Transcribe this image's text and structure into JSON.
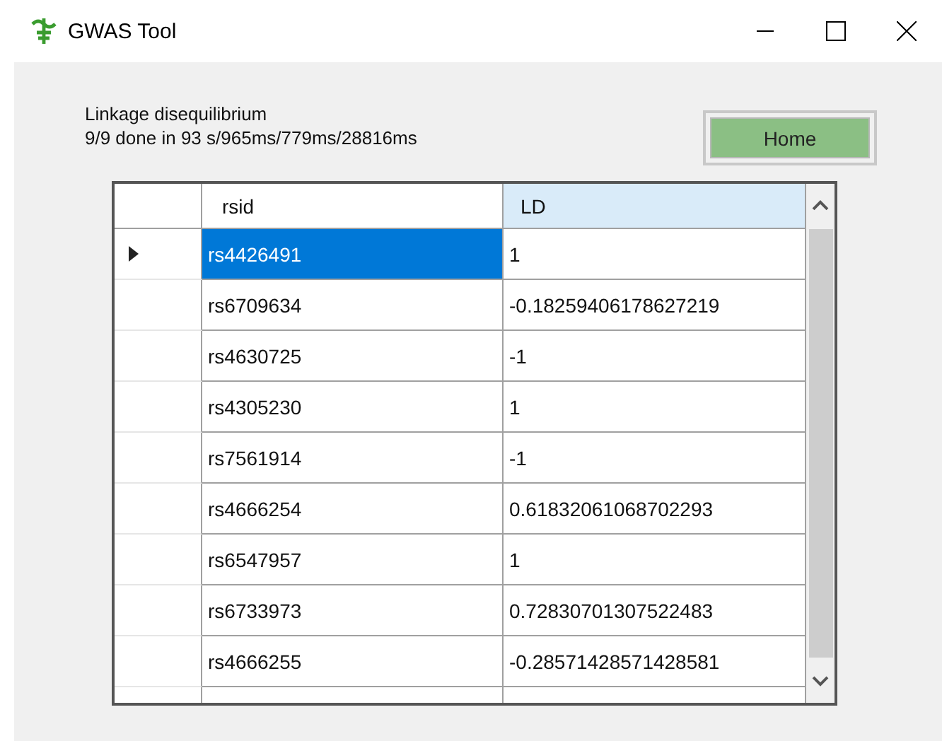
{
  "window": {
    "title": "GWAS Tool"
  },
  "status": {
    "heading": "Linkage disequilibrium",
    "detail": "9/9 done in 93 s/965ms/779ms/28816ms"
  },
  "home_button": {
    "label": "Home"
  },
  "table": {
    "columns": [
      "rsid",
      "LD"
    ],
    "rows": [
      {
        "rsid": "rs4426491",
        "ld": "1",
        "selected": true
      },
      {
        "rsid": "rs6709634",
        "ld": "-0.18259406178627219",
        "selected": false
      },
      {
        "rsid": "rs4630725",
        "ld": "-1",
        "selected": false
      },
      {
        "rsid": "rs4305230",
        "ld": "1",
        "selected": false
      },
      {
        "rsid": "rs7561914",
        "ld": "-1",
        "selected": false
      },
      {
        "rsid": "rs4666254",
        "ld": "0.61832061068702293",
        "selected": false
      },
      {
        "rsid": "rs6547957",
        "ld": "1",
        "selected": false
      },
      {
        "rsid": "rs6733973",
        "ld": "0.72830701307522483",
        "selected": false
      },
      {
        "rsid": "rs4666255",
        "ld": "-0.28571428571428581",
        "selected": false
      }
    ]
  }
}
